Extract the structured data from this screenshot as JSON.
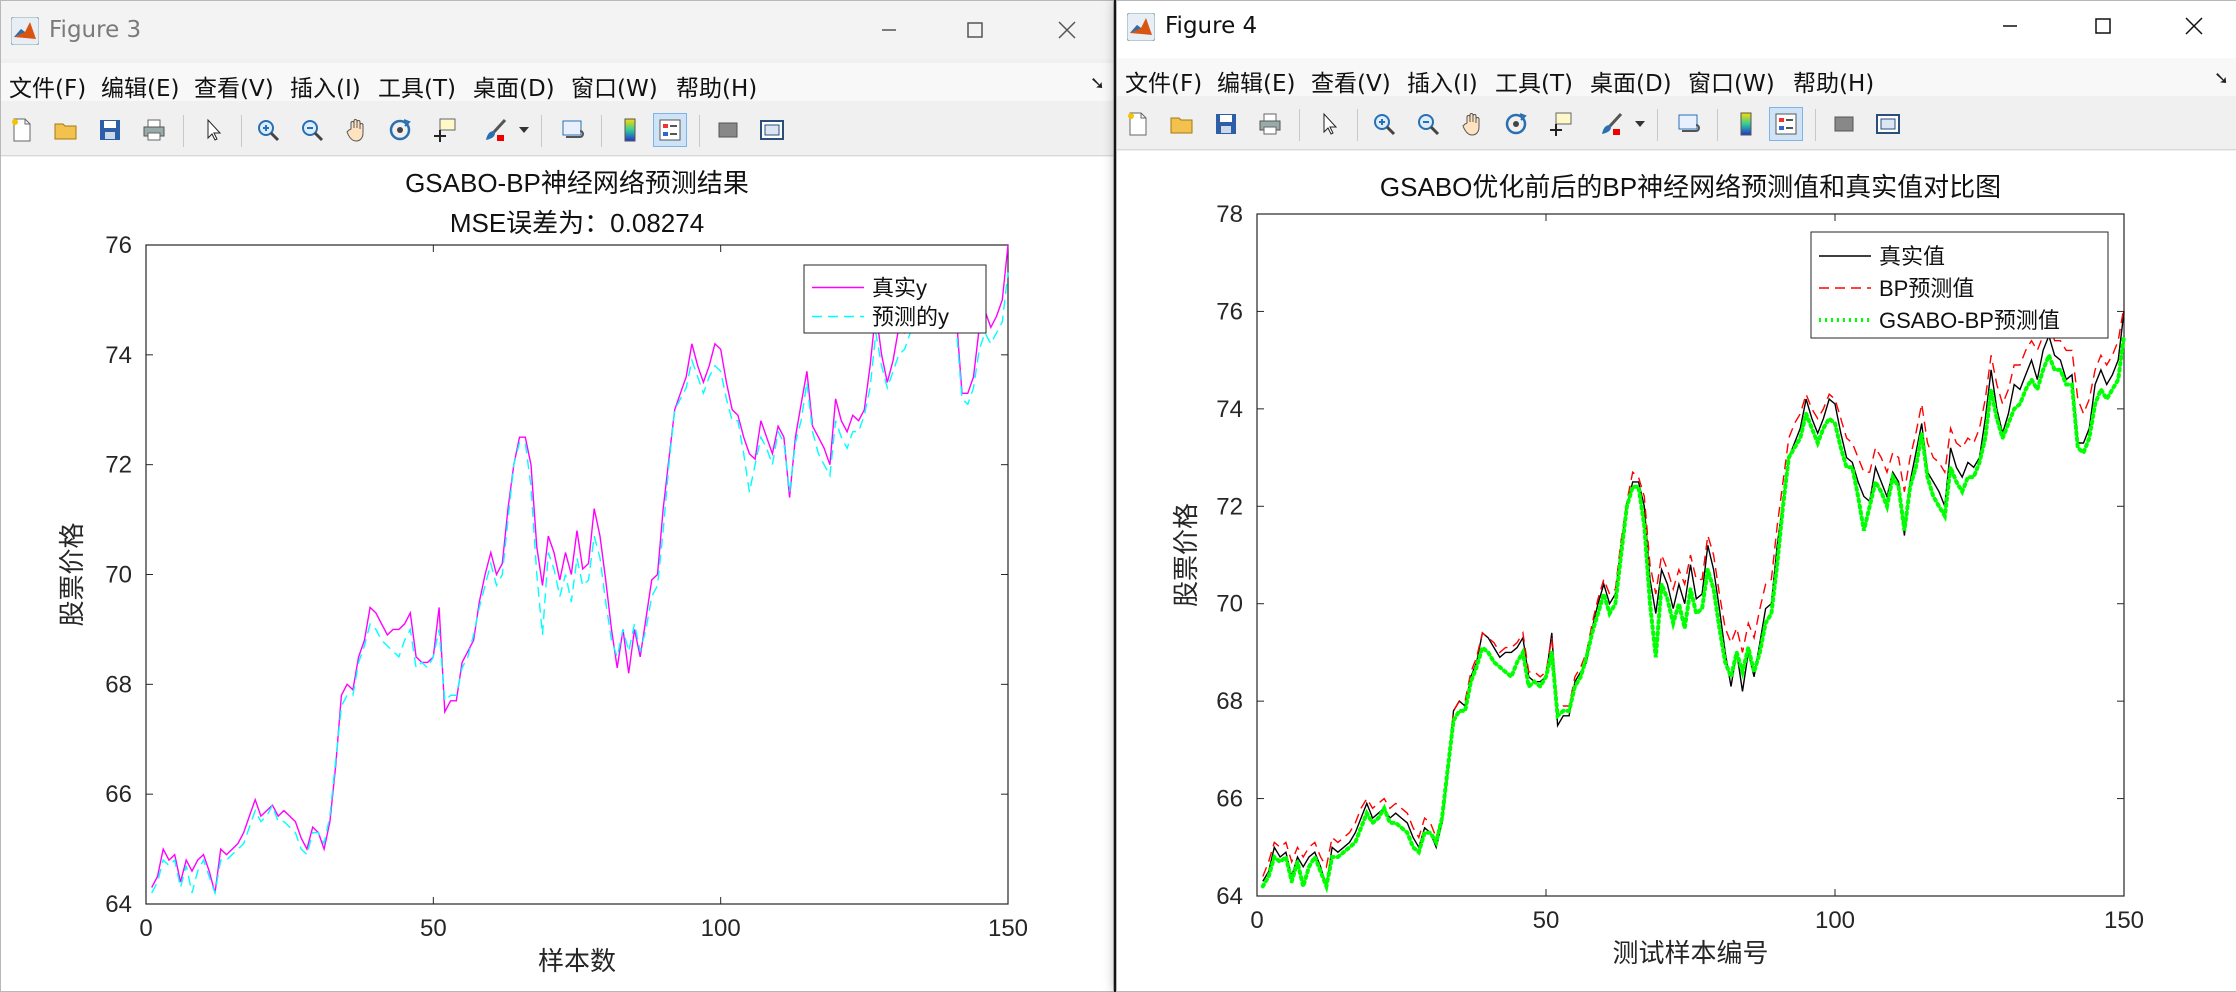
{
  "menus": [
    "文件(F)",
    "编辑(E)",
    "查看(V)",
    "插入(I)",
    "工具(T)",
    "桌面(D)",
    "窗口(W)",
    "帮助(H)"
  ],
  "figure3": {
    "window_title": "Figure 3",
    "chart_data": {
      "type": "line",
      "title": "GSABO-BP神经网络预测结果",
      "subtitle": "MSE误差为：0.08274",
      "xlabel": "样本数",
      "ylabel": "股票价格",
      "xlim": [
        0,
        150
      ],
      "ylim": [
        64,
        76
      ],
      "xticks": [
        0,
        50,
        100,
        150
      ],
      "yticks": [
        64,
        66,
        68,
        70,
        72,
        74,
        76
      ],
      "legend_position": "top-right",
      "grid": false,
      "series": [
        {
          "name": "真实y",
          "color": "#ff00ff",
          "style": "solid",
          "values": [
            64.3,
            64.5,
            65.0,
            64.8,
            64.9,
            64.4,
            64.8,
            64.6,
            64.8,
            64.9,
            64.6,
            64.2,
            65.0,
            64.9,
            65.0,
            65.1,
            65.3,
            65.6,
            65.9,
            65.6,
            65.7,
            65.8,
            65.6,
            65.7,
            65.6,
            65.5,
            65.2,
            65.0,
            65.4,
            65.3,
            65.0,
            65.5,
            66.5,
            67.8,
            68.0,
            67.9,
            68.5,
            68.8,
            69.4,
            69.3,
            69.1,
            68.9,
            69.0,
            69.0,
            69.1,
            69.3,
            68.5,
            68.4,
            68.4,
            68.5,
            69.4,
            67.5,
            67.7,
            67.7,
            68.4,
            68.6,
            68.8,
            69.5,
            70.0,
            70.4,
            70.0,
            70.2,
            71.2,
            72.0,
            72.5,
            72.5,
            72.0,
            70.5,
            69.8,
            70.7,
            70.4,
            69.9,
            70.4,
            70.0,
            70.8,
            70.1,
            70.2,
            71.2,
            70.7,
            69.9,
            69.0,
            68.3,
            69.0,
            68.2,
            69.0,
            68.5,
            69.2,
            69.9,
            70.0,
            71.2,
            72.1,
            73.0,
            73.3,
            73.6,
            74.2,
            73.8,
            73.5,
            73.8,
            74.2,
            74.1,
            73.5,
            73.0,
            72.9,
            72.5,
            72.2,
            72.1,
            72.8,
            72.5,
            72.2,
            72.7,
            72.5,
            71.4,
            72.5,
            73.1,
            73.7,
            72.7,
            72.5,
            72.3,
            72.0,
            73.2,
            72.8,
            72.6,
            72.9,
            72.8,
            73.0,
            73.8,
            74.8,
            74.0,
            73.5,
            73.9,
            74.5,
            74.4,
            74.7,
            75.0,
            74.6,
            75.2,
            75.5,
            75.1,
            75.0,
            74.6,
            74.7,
            73.3,
            73.3,
            73.6,
            74.5,
            74.8,
            74.5,
            74.7,
            75.0,
            76.0
          ]
        },
        {
          "name": "预测的y",
          "color": "#00ffff",
          "style": "dashed",
          "values": [
            64.2,
            64.4,
            64.8,
            64.7,
            64.8,
            64.3,
            64.7,
            64.2,
            64.6,
            64.8,
            64.5,
            64.2,
            64.8,
            64.8,
            64.9,
            65.0,
            65.1,
            65.4,
            65.7,
            65.5,
            65.6,
            65.8,
            65.5,
            65.5,
            65.4,
            65.3,
            65.0,
            64.9,
            65.3,
            65.3,
            65.1,
            65.6,
            66.6,
            67.6,
            67.8,
            67.8,
            68.4,
            68.7,
            69.1,
            69.0,
            68.8,
            68.7,
            68.6,
            68.5,
            68.8,
            69.0,
            68.3,
            68.4,
            68.3,
            68.5,
            69.0,
            67.7,
            67.8,
            67.8,
            68.3,
            68.5,
            68.9,
            69.4,
            69.8,
            70.2,
            69.8,
            70.0,
            71.0,
            72.0,
            72.4,
            72.4,
            71.6,
            70.0,
            68.9,
            70.4,
            70.1,
            69.6,
            70.0,
            69.5,
            70.3,
            69.8,
            69.9,
            70.7,
            70.3,
            69.5,
            68.8,
            68.5,
            69.0,
            68.6,
            69.1,
            68.6,
            69.0,
            69.6,
            69.8,
            70.8,
            72.0,
            73.0,
            73.2,
            73.4,
            73.9,
            73.6,
            73.3,
            73.6,
            73.8,
            73.7,
            73.2,
            72.8,
            72.8,
            72.2,
            71.5,
            72.0,
            72.5,
            72.3,
            72.0,
            72.6,
            72.4,
            71.5,
            72.4,
            72.8,
            73.5,
            72.6,
            72.2,
            72.0,
            71.8,
            72.8,
            72.5,
            72.3,
            72.6,
            72.6,
            72.9,
            73.4,
            74.4,
            73.8,
            73.4,
            73.7,
            74.0,
            74.1,
            74.4,
            74.6,
            74.4,
            74.8,
            75.1,
            74.8,
            74.8,
            74.5,
            74.5,
            73.2,
            73.1,
            73.4,
            74.1,
            74.4,
            74.2,
            74.4,
            74.6,
            75.5
          ]
        }
      ]
    }
  },
  "figure4": {
    "window_title": "Figure 4",
    "chart_data": {
      "type": "line",
      "title": "GSABO优化前后的BP神经网络预测值和真实值对比图",
      "xlabel": "测试样本编号",
      "ylabel": "股票价格",
      "xlim": [
        0,
        150
      ],
      "ylim": [
        64,
        78
      ],
      "xticks": [
        0,
        50,
        100,
        150
      ],
      "yticks": [
        64,
        66,
        68,
        70,
        72,
        74,
        76,
        78
      ],
      "legend_position": "top-right",
      "grid": false,
      "series": [
        {
          "name": "真实值",
          "color": "#000000",
          "style": "solid",
          "values": [
            64.3,
            64.5,
            65.0,
            64.8,
            64.9,
            64.4,
            64.8,
            64.6,
            64.8,
            64.9,
            64.6,
            64.2,
            65.0,
            64.9,
            65.0,
            65.1,
            65.3,
            65.6,
            65.9,
            65.6,
            65.7,
            65.8,
            65.6,
            65.7,
            65.6,
            65.5,
            65.2,
            65.0,
            65.4,
            65.3,
            65.0,
            65.5,
            66.5,
            67.8,
            68.0,
            67.9,
            68.5,
            68.8,
            69.4,
            69.3,
            69.1,
            68.9,
            69.0,
            69.0,
            69.1,
            69.3,
            68.5,
            68.4,
            68.4,
            68.5,
            69.4,
            67.5,
            67.7,
            67.7,
            68.4,
            68.6,
            68.8,
            69.5,
            70.0,
            70.4,
            70.0,
            70.2,
            71.2,
            72.0,
            72.5,
            72.5,
            72.0,
            70.5,
            69.8,
            70.7,
            70.4,
            69.9,
            70.4,
            70.0,
            70.8,
            70.1,
            70.2,
            71.2,
            70.7,
            69.9,
            69.0,
            68.3,
            69.0,
            68.2,
            69.0,
            68.5,
            69.2,
            69.9,
            70.0,
            71.2,
            72.1,
            73.0,
            73.3,
            73.6,
            74.2,
            73.8,
            73.5,
            73.8,
            74.2,
            74.1,
            73.5,
            73.0,
            72.9,
            72.5,
            72.2,
            72.1,
            72.8,
            72.5,
            72.2,
            72.7,
            72.5,
            71.4,
            72.5,
            73.1,
            73.7,
            72.7,
            72.5,
            72.3,
            72.0,
            73.2,
            72.8,
            72.6,
            72.9,
            72.8,
            73.0,
            73.8,
            74.8,
            74.0,
            73.5,
            73.9,
            74.5,
            74.4,
            74.7,
            75.0,
            74.6,
            75.2,
            75.5,
            75.1,
            75.0,
            74.6,
            74.7,
            73.3,
            73.3,
            73.6,
            74.5,
            74.8,
            74.5,
            74.7,
            75.0,
            76.0
          ]
        },
        {
          "name": "BP预测值",
          "color": "#ff0000",
          "style": "dashed",
          "values": [
            64.4,
            64.7,
            65.1,
            65.0,
            65.1,
            64.7,
            65.0,
            64.8,
            65.0,
            65.1,
            64.8,
            64.6,
            65.2,
            65.1,
            65.2,
            65.3,
            65.5,
            65.8,
            66.0,
            65.8,
            65.9,
            66.0,
            65.8,
            65.9,
            65.8,
            65.7,
            65.4,
            65.2,
            65.6,
            65.5,
            65.2,
            65.6,
            66.6,
            67.8,
            68.0,
            68.0,
            68.6,
            68.9,
            69.4,
            69.3,
            69.2,
            69.0,
            69.1,
            69.1,
            69.2,
            69.4,
            68.6,
            68.6,
            68.5,
            68.6,
            69.3,
            67.8,
            67.9,
            67.9,
            68.5,
            68.7,
            69.0,
            69.6,
            70.1,
            70.5,
            70.2,
            70.3,
            71.3,
            72.1,
            72.7,
            72.6,
            72.2,
            70.8,
            70.2,
            71.0,
            70.7,
            70.3,
            70.7,
            70.4,
            71.0,
            70.5,
            70.5,
            71.4,
            71.0,
            70.2,
            69.5,
            69.2,
            69.5,
            69.0,
            69.6,
            69.3,
            69.9,
            70.4,
            70.5,
            71.6,
            72.5,
            73.4,
            73.7,
            73.9,
            74.3,
            74.0,
            73.8,
            74.0,
            74.3,
            74.2,
            73.8,
            73.4,
            73.3,
            73.0,
            72.7,
            72.7,
            73.2,
            73.0,
            72.7,
            73.1,
            73.0,
            72.3,
            73.0,
            73.5,
            74.1,
            73.3,
            73.0,
            72.9,
            72.7,
            73.6,
            73.3,
            73.2,
            73.4,
            73.3,
            73.6,
            74.2,
            75.1,
            74.5,
            74.1,
            74.4,
            74.9,
            74.9,
            75.2,
            75.4,
            75.2,
            75.5,
            75.8,
            75.4,
            75.4,
            75.2,
            75.2,
            74.2,
            73.9,
            74.2,
            74.8,
            75.1,
            74.9,
            75.1,
            75.4,
            76.1
          ]
        },
        {
          "name": "GSABO-BP预测值",
          "color": "#00ff00",
          "style": "dotted",
          "values": [
            64.2,
            64.4,
            64.8,
            64.7,
            64.8,
            64.3,
            64.7,
            64.2,
            64.6,
            64.8,
            64.5,
            64.2,
            64.8,
            64.8,
            64.9,
            65.0,
            65.1,
            65.4,
            65.7,
            65.5,
            65.6,
            65.8,
            65.5,
            65.5,
            65.4,
            65.3,
            65.0,
            64.9,
            65.3,
            65.3,
            65.1,
            65.6,
            66.6,
            67.6,
            67.8,
            67.8,
            68.4,
            68.7,
            69.1,
            69.0,
            68.8,
            68.7,
            68.6,
            68.5,
            68.8,
            69.0,
            68.3,
            68.4,
            68.3,
            68.5,
            69.0,
            67.7,
            67.8,
            67.8,
            68.3,
            68.5,
            68.9,
            69.4,
            69.8,
            70.2,
            69.8,
            70.0,
            71.0,
            72.0,
            72.4,
            72.4,
            71.6,
            70.0,
            68.9,
            70.4,
            70.1,
            69.6,
            70.0,
            69.5,
            70.3,
            69.8,
            69.9,
            70.7,
            70.3,
            69.5,
            68.8,
            68.5,
            69.0,
            68.6,
            69.1,
            68.6,
            69.0,
            69.6,
            69.8,
            70.8,
            72.0,
            73.0,
            73.2,
            73.4,
            73.9,
            73.6,
            73.3,
            73.6,
            73.8,
            73.7,
            73.2,
            72.8,
            72.8,
            72.2,
            71.5,
            72.0,
            72.5,
            72.3,
            72.0,
            72.6,
            72.4,
            71.5,
            72.4,
            72.8,
            73.5,
            72.6,
            72.2,
            72.0,
            71.8,
            72.8,
            72.5,
            72.3,
            72.6,
            72.6,
            72.9,
            73.4,
            74.4,
            73.8,
            73.4,
            73.7,
            74.0,
            74.1,
            74.4,
            74.6,
            74.4,
            74.8,
            75.1,
            74.8,
            74.8,
            74.5,
            74.5,
            73.2,
            73.1,
            73.4,
            74.1,
            74.4,
            74.2,
            74.4,
            74.6,
            75.5
          ]
        }
      ]
    }
  }
}
